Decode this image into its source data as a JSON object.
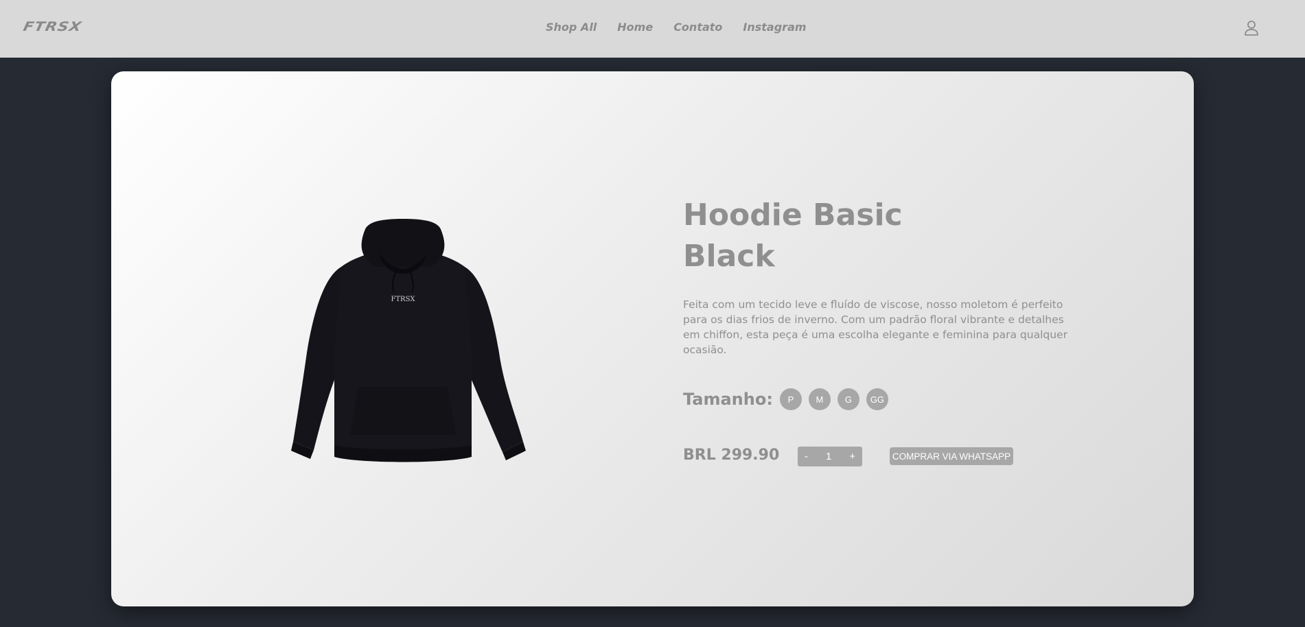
{
  "header": {
    "logo_text": "FTRSX",
    "nav": [
      "Shop All",
      "Home",
      "Contato",
      "Instagram"
    ],
    "account_icon": "user-icon"
  },
  "product": {
    "title": "Hoodie Basic Black",
    "hoodie_print": "FTRSX",
    "description": "Feita com um tecido leve e fluído de viscose, nosso moletom é perfeito para os dias frios de inverno. Com um padrão floral vibrante e detalhes em chiffon, esta peça é uma escolha elegante e feminina para qualquer ocasião.",
    "size_label": "Tamanho:",
    "sizes": [
      "P",
      "M",
      "G",
      "GG"
    ],
    "price": "BRL 299.90",
    "quantity": {
      "minus": "-",
      "value": "1",
      "plus": "+"
    },
    "buy_label": "COMPRAR VIA WHATSAPP"
  },
  "colors": {
    "page_bg": "#262a33",
    "header_bg": "#d9d9d9",
    "text_gray": "#8f8f8f",
    "button_gray": "#a7a7a7"
  }
}
